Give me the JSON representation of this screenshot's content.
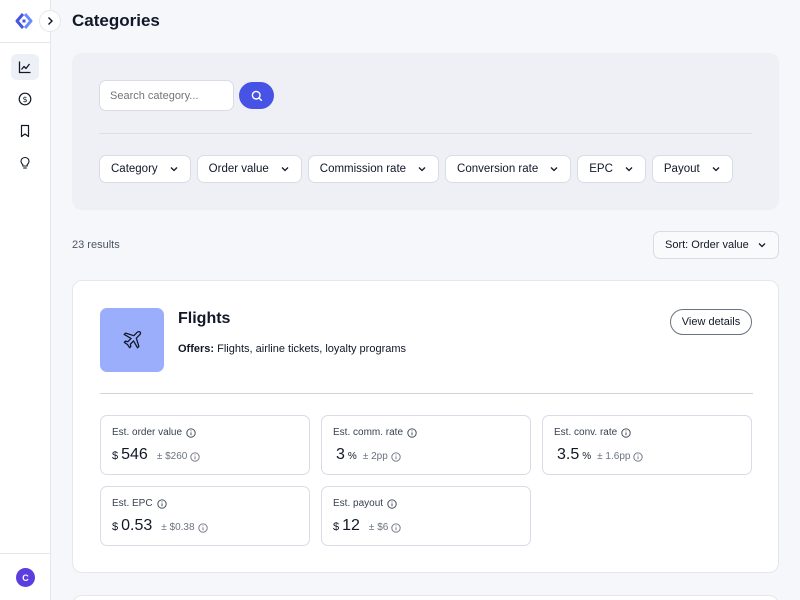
{
  "app": {
    "avatar_initial": "C",
    "accent_color": "#4753e4",
    "avatar_color": "#5b3ee0"
  },
  "sidebar": {
    "items": [
      {
        "name": "analytics",
        "icon": "chart-line-icon",
        "active": true
      },
      {
        "name": "earnings",
        "icon": "dollar-circle-icon",
        "active": false
      },
      {
        "name": "saved",
        "icon": "bookmark-icon",
        "active": false
      },
      {
        "name": "ideas",
        "icon": "lightbulb-icon",
        "active": false
      }
    ]
  },
  "header": {
    "title": "Categories"
  },
  "filters": {
    "search_placeholder": "Search category...",
    "dropdowns": [
      "Category",
      "Order value",
      "Commission rate",
      "Conversion rate",
      "EPC",
      "Payout"
    ]
  },
  "results": {
    "count_text": "23 results",
    "sort_label": "Sort: Order value"
  },
  "card": {
    "name": "Flights",
    "icon": "airplane-icon",
    "icon_bg": "#9aaefc",
    "offers_label": "Offers:",
    "offers_text": "Flights, airline tickets, loyalty programs",
    "view_details_label": "View details",
    "metrics": [
      {
        "label": "Est. order value",
        "prefix": "$",
        "value": "546",
        "suffix": "",
        "range": "± $260"
      },
      {
        "label": "Est. comm. rate",
        "prefix": "",
        "value": "3",
        "suffix": "%",
        "range": "± 2pp"
      },
      {
        "label": "Est. conv. rate",
        "prefix": "",
        "value": "3.5",
        "suffix": "%",
        "range": "± 1.6pp"
      },
      {
        "label": "Est. EPC",
        "prefix": "$",
        "value": "0.53",
        "suffix": "",
        "range": "± $0.38"
      },
      {
        "label": "Est. payout",
        "prefix": "$",
        "value": "12",
        "suffix": "",
        "range": "± $6"
      }
    ]
  }
}
